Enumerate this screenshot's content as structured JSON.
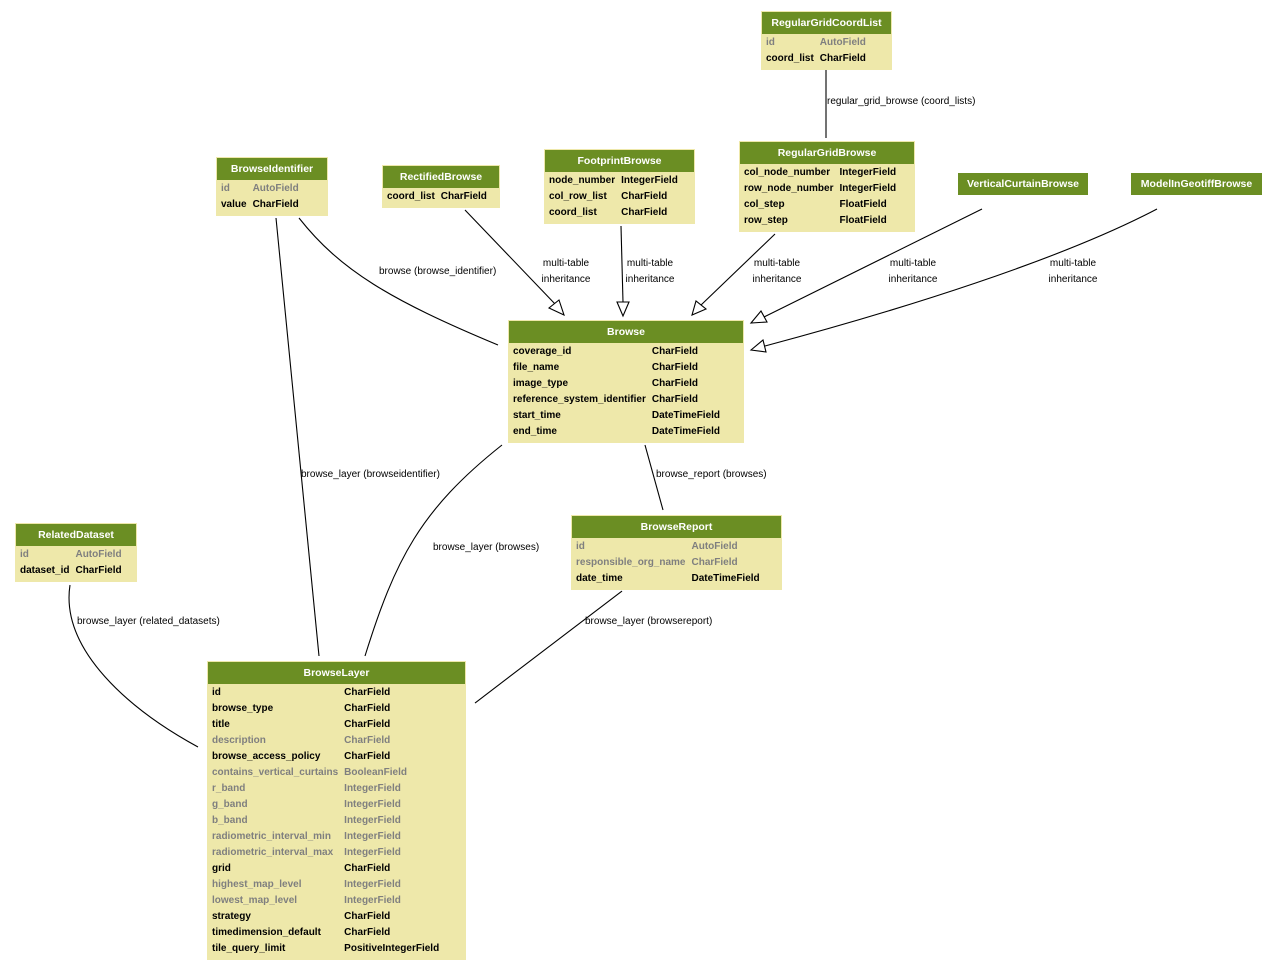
{
  "colors": {
    "header_bg": "#6b8e23",
    "header_text": "#ffffff",
    "body_bg": "#eee8aa",
    "faded_text": "#7f7f7f"
  },
  "models": {
    "regular_grid_coord_list": {
      "name": "RegularGridCoordList",
      "fields": [
        {
          "name": "id",
          "type": "AutoField",
          "faded": true
        },
        {
          "name": "coord_list",
          "type": "CharField",
          "faded": false
        }
      ]
    },
    "browse_identifier": {
      "name": "BrowseIdentifier",
      "fields": [
        {
          "name": "id",
          "type": "AutoField",
          "faded": true
        },
        {
          "name": "value",
          "type": "CharField",
          "faded": false
        }
      ]
    },
    "rectified_browse": {
      "name": "RectifiedBrowse",
      "fields": [
        {
          "name": "coord_list",
          "type": "CharField",
          "faded": false
        }
      ]
    },
    "footprint_browse": {
      "name": "FootprintBrowse",
      "fields": [
        {
          "name": "node_number",
          "type": "IntegerField",
          "faded": false
        },
        {
          "name": "col_row_list",
          "type": "CharField",
          "faded": false
        },
        {
          "name": "coord_list",
          "type": "CharField",
          "faded": false
        }
      ]
    },
    "regular_grid_browse": {
      "name": "RegularGridBrowse",
      "fields": [
        {
          "name": "col_node_number",
          "type": "IntegerField",
          "faded": false
        },
        {
          "name": "row_node_number",
          "type": "IntegerField",
          "faded": false
        },
        {
          "name": "col_step",
          "type": "FloatField",
          "faded": false
        },
        {
          "name": "row_step",
          "type": "FloatField",
          "faded": false
        }
      ]
    },
    "vertical_curtain_browse": {
      "name": "VerticalCurtainBrowse",
      "fields": []
    },
    "model_in_geotiff_browse": {
      "name": "ModelInGeotiffBrowse",
      "fields": []
    },
    "browse": {
      "name": "Browse",
      "fields": [
        {
          "name": "coverage_id",
          "type": "CharField",
          "faded": false
        },
        {
          "name": "file_name",
          "type": "CharField",
          "faded": false
        },
        {
          "name": "image_type",
          "type": "CharField",
          "faded": false
        },
        {
          "name": "reference_system_identifier",
          "type": "CharField",
          "faded": false
        },
        {
          "name": "start_time",
          "type": "DateTimeField",
          "faded": false
        },
        {
          "name": "end_time",
          "type": "DateTimeField",
          "faded": false
        }
      ]
    },
    "browse_report": {
      "name": "BrowseReport",
      "fields": [
        {
          "name": "id",
          "type": "AutoField",
          "faded": true
        },
        {
          "name": "responsible_org_name",
          "type": "CharField",
          "faded": true
        },
        {
          "name": "date_time",
          "type": "DateTimeField",
          "faded": false
        }
      ]
    },
    "related_dataset": {
      "name": "RelatedDataset",
      "fields": [
        {
          "name": "id",
          "type": "AutoField",
          "faded": true
        },
        {
          "name": "dataset_id",
          "type": "CharField",
          "faded": false
        }
      ]
    },
    "browse_layer": {
      "name": "BrowseLayer",
      "fields": [
        {
          "name": "id",
          "type": "CharField",
          "faded": false
        },
        {
          "name": "browse_type",
          "type": "CharField",
          "faded": false
        },
        {
          "name": "title",
          "type": "CharField",
          "faded": false
        },
        {
          "name": "description",
          "type": "CharField",
          "faded": true
        },
        {
          "name": "browse_access_policy",
          "type": "CharField",
          "faded": false
        },
        {
          "name": "contains_vertical_curtains",
          "type": "BooleanField",
          "faded": true
        },
        {
          "name": "r_band",
          "type": "IntegerField",
          "faded": true
        },
        {
          "name": "g_band",
          "type": "IntegerField",
          "faded": true
        },
        {
          "name": "b_band",
          "type": "IntegerField",
          "faded": true
        },
        {
          "name": "radiometric_interval_min",
          "type": "IntegerField",
          "faded": true
        },
        {
          "name": "radiometric_interval_max",
          "type": "IntegerField",
          "faded": true
        },
        {
          "name": "grid",
          "type": "CharField",
          "faded": false
        },
        {
          "name": "highest_map_level",
          "type": "IntegerField",
          "faded": true
        },
        {
          "name": "lowest_map_level",
          "type": "IntegerField",
          "faded": true
        },
        {
          "name": "strategy",
          "type": "CharField",
          "faded": false
        },
        {
          "name": "timedimension_default",
          "type": "CharField",
          "faded": false
        },
        {
          "name": "tile_query_limit",
          "type": "PositiveIntegerField",
          "faded": false
        }
      ]
    }
  },
  "edge_labels": {
    "regular_grid_browse_coord_lists": "regular_grid_browse (coord_lists)",
    "browse_browse_identifier": "browse (browse_identifier)",
    "mti_line1": "multi-table",
    "mti_line2": "inheritance",
    "browse_layer_browseidentifier": "browse_layer (browseidentifier)",
    "browse_report_browses": "browse_report (browses)",
    "browse_layer_browses": "browse_layer (browses)",
    "browse_layer_related_datasets": "browse_layer (related_datasets)",
    "browse_layer_browsereport": "browse_layer (browsereport)"
  }
}
